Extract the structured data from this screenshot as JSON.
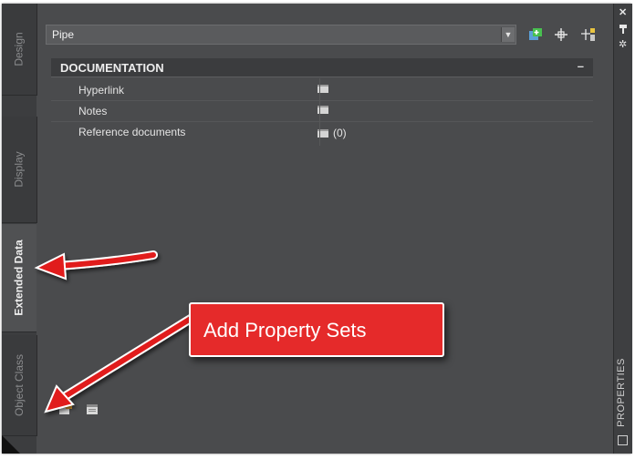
{
  "palette": {
    "title": "PROPERTIES",
    "tabs": [
      {
        "label": "Design",
        "active": false
      },
      {
        "label": "Display",
        "active": false
      },
      {
        "label": "Extended Data",
        "active": true
      },
      {
        "label": "Object Class",
        "active": false
      }
    ],
    "right_strip_icons": [
      "close-icon",
      "pin-icon",
      "settings-icon"
    ]
  },
  "header": {
    "object_type": "Pipe",
    "toolbar_icons": [
      "select-objects-icon",
      "pick-add-icon",
      "quick-select-icon"
    ]
  },
  "category": {
    "title": "DOCUMENTATION",
    "collapse_symbol": "–",
    "rows": [
      {
        "name": "Hyperlink",
        "value": ""
      },
      {
        "name": "Notes",
        "value": ""
      },
      {
        "name": "Reference documents",
        "value": "(0)"
      }
    ]
  },
  "bottom_buttons": [
    "add-property-sets-icon",
    "edit-property-sets-icon"
  ],
  "callout": {
    "text": "Add Property Sets"
  },
  "colors": {
    "panel_bg": "#4a4b4d",
    "tab_active": "#505153",
    "callout_red": "#e52a2a",
    "arrow_red": "#e11f1f"
  }
}
